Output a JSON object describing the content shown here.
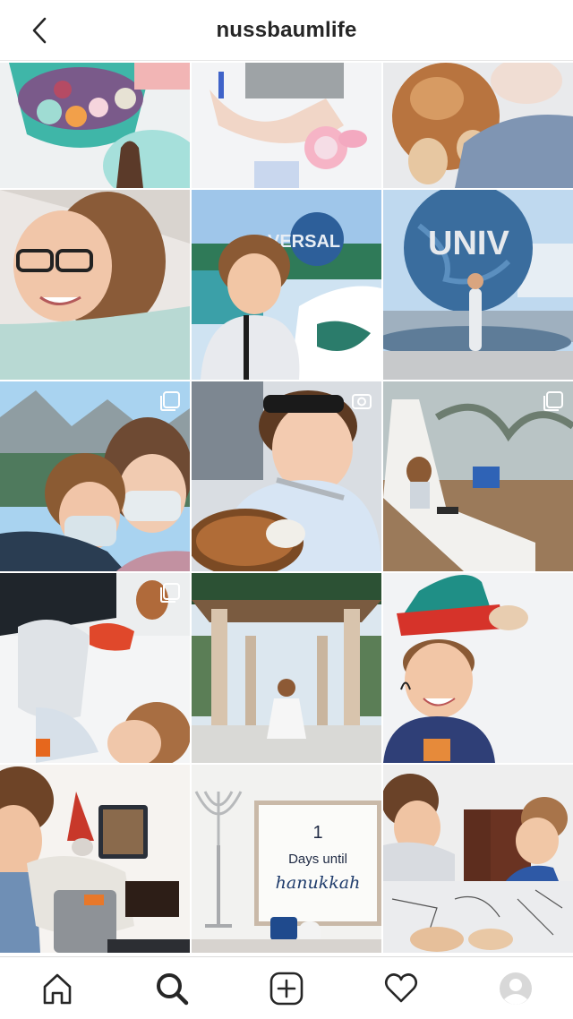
{
  "header": {
    "username": "nussbaumlife",
    "back_icon": "chevron-left-icon"
  },
  "grid": {
    "posts": [
      {
        "description": "",
        "multi": false
      },
      {
        "description": "",
        "multi": false
      },
      {
        "description": "",
        "multi": false
      },
      {
        "description": "",
        "multi": false
      },
      {
        "description": "",
        "multi": false
      },
      {
        "description": "",
        "multi": false
      },
      {
        "description": "",
        "multi": true
      },
      {
        "description": "",
        "multi": true
      },
      {
        "description": "",
        "multi": true
      },
      {
        "description": "",
        "multi": true
      },
      {
        "description": "",
        "multi": false
      },
      {
        "description": "",
        "multi": false
      },
      {
        "description": "",
        "multi": false
      },
      {
        "description": "",
        "multi": false
      },
      {
        "description": "",
        "multi": false
      }
    ],
    "photo_text": {
      "universal_sign_1": "VERSAL",
      "universal_sign_2": "UNIV",
      "countdown_number": "1",
      "countdown_line1": "Days until",
      "countdown_line2": "hanukkah"
    }
  },
  "bottom_nav": {
    "items": [
      "home-icon",
      "search-icon",
      "new-post-icon",
      "activity-heart-icon",
      "profile-avatar-icon"
    ],
    "active": "search-icon"
  },
  "colors": {
    "text": "#262626",
    "divider": "#dbdbdb",
    "background": "#ffffff"
  }
}
